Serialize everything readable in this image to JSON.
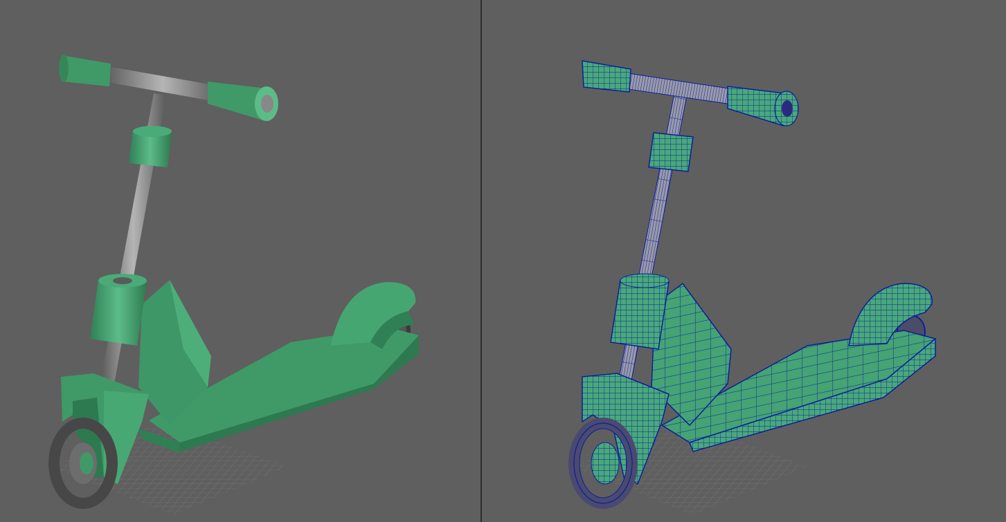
{
  "layout": "split-viewport",
  "viewports": [
    {
      "name": "shaded",
      "display_mode": "smooth-shaded"
    },
    {
      "name": "wireframe-on-shaded",
      "display_mode": "wireframe-on-shaded"
    }
  ],
  "model": {
    "name": "kick-scooter",
    "colors": {
      "body_green": "#3f9a68",
      "body_green_light": "#5fbf8a",
      "body_green_dark": "#2d7a50",
      "metal": "#8c8c8c",
      "tire": "#4a4a4a",
      "wire_blue": "#0b1f9a",
      "background": "#5f5f5f",
      "grid": "#777777"
    }
  }
}
